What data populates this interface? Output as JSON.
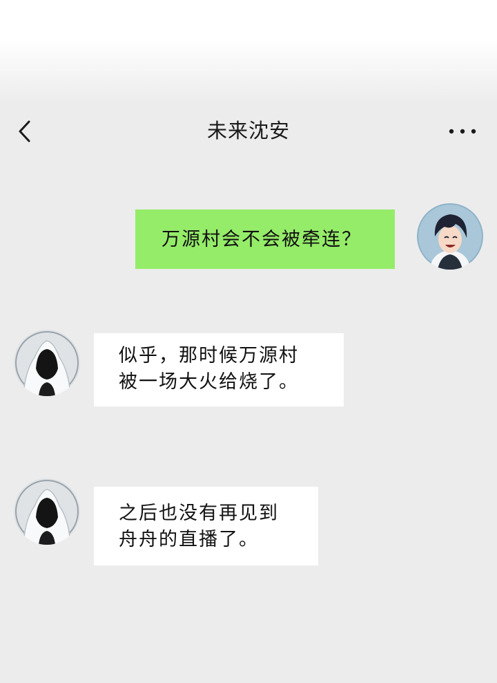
{
  "header": {
    "title": "未来沈安",
    "back_icon": "chevron-left-icon",
    "more_icon": "more-dots-icon"
  },
  "messages": [
    {
      "sender": "self",
      "lines": [
        "万源村会不会被牵连？"
      ],
      "bubble_color": "#95ec69"
    },
    {
      "sender": "other",
      "lines": [
        "似乎，那时候万源村",
        "被一场大火给烧了。"
      ],
      "bubble_color": "#ffffff"
    },
    {
      "sender": "other",
      "lines": [
        "之后也没有再见到",
        "舟舟的直播了。"
      ],
      "bubble_color": "#ffffff"
    }
  ],
  "colors": {
    "background": "#ececec",
    "outgoing_bubble": "#95ec69",
    "incoming_bubble": "#ffffff"
  }
}
